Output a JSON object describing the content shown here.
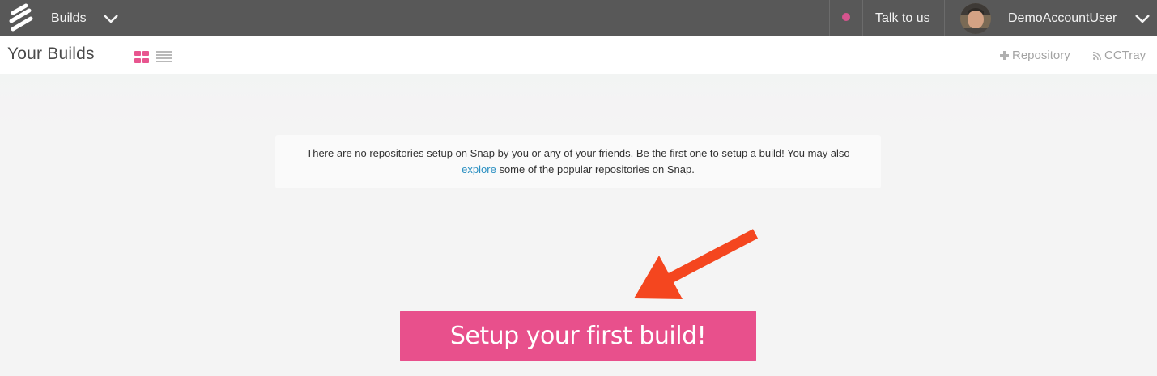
{
  "topbar": {
    "nav_label": "Builds",
    "talk_label": "Talk to us",
    "username": "DemoAccountUser",
    "status_color": "#d6548e"
  },
  "subheader": {
    "title": "Your Builds",
    "repository_link": "Repository",
    "cctray_link": "CCTray"
  },
  "notice": {
    "text_before": "There are no repositories setup on Snap by you or any of your friends. Be the first one to setup a build! You may also",
    "link_text": "explore",
    "text_after": "some of the popular repositories on Snap."
  },
  "cta": {
    "label": "Setup your first build!"
  },
  "colors": {
    "accent": "#e8508c",
    "annotation_arrow": "#f4461f",
    "link": "#2a8fc1"
  },
  "icons": [
    "snap-logo-icon",
    "chevron-down-icon",
    "grid-view-icon",
    "list-view-icon",
    "plus-icon",
    "rss-icon",
    "annotation-arrow-icon"
  ]
}
